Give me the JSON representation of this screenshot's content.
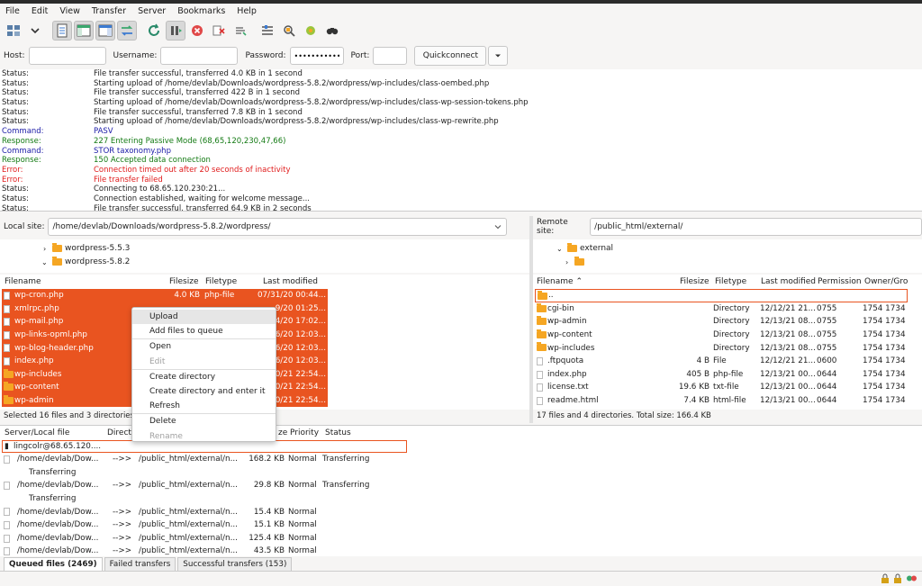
{
  "menubar": [
    "File",
    "Edit",
    "View",
    "Transfer",
    "Server",
    "Bookmarks",
    "Help"
  ],
  "toolbar": {
    "icons": [
      "site-manager-icon",
      "dropdown-arrow-icon",
      "toggle-log-icon",
      "toggle-local-tree-icon",
      "toggle-remote-tree-icon",
      "toggle-queue-icon",
      "refresh-icon",
      "process-queue-icon",
      "cancel-icon",
      "disconnect-icon",
      "reconnect-icon",
      "filter-icon",
      "compare-icon",
      "sync-browse-icon",
      "search-icon"
    ]
  },
  "quickconnect": {
    "host_label": "Host:",
    "username_label": "Username:",
    "password_label": "Password:",
    "password_value": "••••••••••••••••",
    "port_label": "Port:",
    "button": "Quickconnect"
  },
  "log": [
    {
      "type": "Status:",
      "kind": "status",
      "text": "File transfer successful, transferred 4.0 KB in 1 second"
    },
    {
      "type": "Status:",
      "kind": "status",
      "text": "Starting upload of /home/devlab/Downloads/wordpress-5.8.2/wordpress/wp-includes/class-oembed.php"
    },
    {
      "type": "Status:",
      "kind": "status",
      "text": "File transfer successful, transferred 422 B in 1 second"
    },
    {
      "type": "Status:",
      "kind": "status",
      "text": "Starting upload of /home/devlab/Downloads/wordpress-5.8.2/wordpress/wp-includes/class-wp-session-tokens.php"
    },
    {
      "type": "Status:",
      "kind": "status",
      "text": "File transfer successful, transferred 7.8 KB in 1 second"
    },
    {
      "type": "Status:",
      "kind": "status",
      "text": "Starting upload of /home/devlab/Downloads/wordpress-5.8.2/wordpress/wp-includes/class-wp-rewrite.php"
    },
    {
      "type": "Command:",
      "kind": "command",
      "text": "PASV"
    },
    {
      "type": "Response:",
      "kind": "response",
      "text": "227 Entering Passive Mode (68,65,120,230,47,66)"
    },
    {
      "type": "Command:",
      "kind": "command",
      "text": "STOR taxonomy.php"
    },
    {
      "type": "Response:",
      "kind": "response",
      "text": "150 Accepted data connection"
    },
    {
      "type": "Error:",
      "kind": "error",
      "text": "Connection timed out after 20 seconds of inactivity"
    },
    {
      "type": "Error:",
      "kind": "error",
      "text": "File transfer failed"
    },
    {
      "type": "Status:",
      "kind": "status",
      "text": "Connecting to 68.65.120.230:21..."
    },
    {
      "type": "Status:",
      "kind": "status",
      "text": "Connection established, waiting for welcome message..."
    },
    {
      "type": "Status:",
      "kind": "status",
      "text": "File transfer successful, transferred 64.9 KB in 2 seconds"
    }
  ],
  "local": {
    "label": "Local site:",
    "path": "/home/devlab/Downloads/wordpress-5.8.2/wordpress/",
    "tree": [
      "wordpress-5.5.3",
      "wordpress-5.8.2"
    ],
    "headers": [
      "Filename",
      "Filesize",
      "Filetype",
      "Last modified"
    ],
    "files": [
      {
        "name": "wp-cron.php",
        "size": "4.0 KB",
        "type": "php-file",
        "mod": "07/31/20 00:44...",
        "folder": false
      },
      {
        "name": "xmlrpc.php",
        "size": "",
        "type": "",
        "mod": "9/20 01:25...",
        "folder": false
      },
      {
        "name": "wp-mail.php",
        "size": "",
        "type": "",
        "mod": "4/20 17:02...",
        "folder": false
      },
      {
        "name": "wp-links-opml.php",
        "size": "",
        "type": "",
        "mod": "6/20 12:03...",
        "folder": false
      },
      {
        "name": "wp-blog-header.php",
        "size": "",
        "type": "",
        "mod": "6/20 12:03...",
        "folder": false
      },
      {
        "name": "index.php",
        "size": "",
        "type": "",
        "mod": "6/20 12:03...",
        "folder": false
      },
      {
        "name": "wp-includes",
        "size": "",
        "type": "",
        "mod": "0/21 22:54...",
        "folder": true
      },
      {
        "name": "wp-content",
        "size": "",
        "type": "",
        "mod": "0/21 22:54...",
        "folder": true
      },
      {
        "name": "wp-admin",
        "size": "",
        "type": "",
        "mod": "0/21 22:54...",
        "folder": true
      }
    ],
    "status": "Selected 16 files and 3 directories"
  },
  "remote": {
    "label": "Remote site:",
    "path": "/public_html/external/",
    "tree": [
      "external"
    ],
    "headers": [
      "Filename",
      "Filesize",
      "Filetype",
      "Last modified",
      "Permission",
      "Owner/Gro"
    ],
    "files": [
      {
        "name": "..",
        "size": "",
        "type": "",
        "mod": "",
        "perm": "",
        "owner": "",
        "folder": true
      },
      {
        "name": "cgi-bin",
        "size": "",
        "type": "Directory",
        "mod": "12/12/21 21...",
        "perm": "0755",
        "owner": "1754 1734",
        "folder": true
      },
      {
        "name": "wp-admin",
        "size": "",
        "type": "Directory",
        "mod": "12/13/21 08...",
        "perm": "0755",
        "owner": "1754 1734",
        "folder": true
      },
      {
        "name": "wp-content",
        "size": "",
        "type": "Directory",
        "mod": "12/13/21 08...",
        "perm": "0755",
        "owner": "1754 1734",
        "folder": true
      },
      {
        "name": "wp-includes",
        "size": "",
        "type": "Directory",
        "mod": "12/13/21 08...",
        "perm": "0755",
        "owner": "1754 1734",
        "folder": true
      },
      {
        "name": ".ftpquota",
        "size": "4 B",
        "type": "File",
        "mod": "12/12/21 21...",
        "perm": "0600",
        "owner": "1754 1734",
        "folder": false
      },
      {
        "name": "index.php",
        "size": "405 B",
        "type": "php-file",
        "mod": "12/13/21 00...",
        "perm": "0644",
        "owner": "1754 1734",
        "folder": false
      },
      {
        "name": "license.txt",
        "size": "19.6 KB",
        "type": "txt-file",
        "mod": "12/13/21 00...",
        "perm": "0644",
        "owner": "1754 1734",
        "folder": false
      },
      {
        "name": "readme.html",
        "size": "7.4 KB",
        "type": "html-file",
        "mod": "12/13/21 00...",
        "perm": "0644",
        "owner": "1754 1734",
        "folder": false
      }
    ],
    "status": "17 files and 4 directories. Total size: 166.4 KB"
  },
  "context_menu": [
    {
      "label": "Upload",
      "state": "hover"
    },
    {
      "label": "Add files to queue",
      "state": "normal"
    },
    {
      "sep": true
    },
    {
      "label": "Open",
      "state": "normal"
    },
    {
      "label": "Edit",
      "state": "disabled"
    },
    {
      "sep": true
    },
    {
      "label": "Create directory",
      "state": "normal"
    },
    {
      "label": "Create directory and enter it",
      "state": "normal"
    },
    {
      "label": "Refresh",
      "state": "normal"
    },
    {
      "sep": true
    },
    {
      "label": "Delete",
      "state": "normal"
    },
    {
      "label": "Rename",
      "state": "disabled"
    }
  ],
  "queue": {
    "headers": [
      "Server/Local file",
      "Directi",
      "ze",
      "Priority",
      "Status"
    ],
    "server": "lingcolr@68.65.120....",
    "rows": [
      {
        "local": "/home/devlab/Dow...",
        "dir": "-->>",
        "remote": "/public_html/external/n...",
        "size": "168.2 KB",
        "priority": "Normal",
        "status": "Transferring",
        "sub": "Transferring"
      },
      {
        "local": "/home/devlab/Dow...",
        "dir": "-->>",
        "remote": "/public_html/external/n...",
        "size": "29.8 KB",
        "priority": "Normal",
        "status": "Transferring",
        "sub": "Transferring"
      },
      {
        "local": "/home/devlab/Dow...",
        "dir": "-->>",
        "remote": "/public_html/external/n...",
        "size": "15.4 KB",
        "priority": "Normal",
        "status": "",
        "sub": ""
      },
      {
        "local": "/home/devlab/Dow...",
        "dir": "-->>",
        "remote": "/public_html/external/n...",
        "size": "15.1 KB",
        "priority": "Normal",
        "status": "",
        "sub": ""
      },
      {
        "local": "/home/devlab/Dow...",
        "dir": "-->>",
        "remote": "/public_html/external/n...",
        "size": "125.4 KB",
        "priority": "Normal",
        "status": "",
        "sub": ""
      },
      {
        "local": "/home/devlab/Dow...",
        "dir": "-->>",
        "remote": "/public_html/external/n...",
        "size": "43.5 KB",
        "priority": "Normal",
        "status": "",
        "sub": ""
      }
    ]
  },
  "tabs": [
    "Queued files (2469)",
    "Failed transfers",
    "Successful transfers (153)"
  ],
  "colors": {
    "selection": "#e95420",
    "error": "#e01b1b",
    "command": "#1a1aa6",
    "response": "#137a13"
  }
}
